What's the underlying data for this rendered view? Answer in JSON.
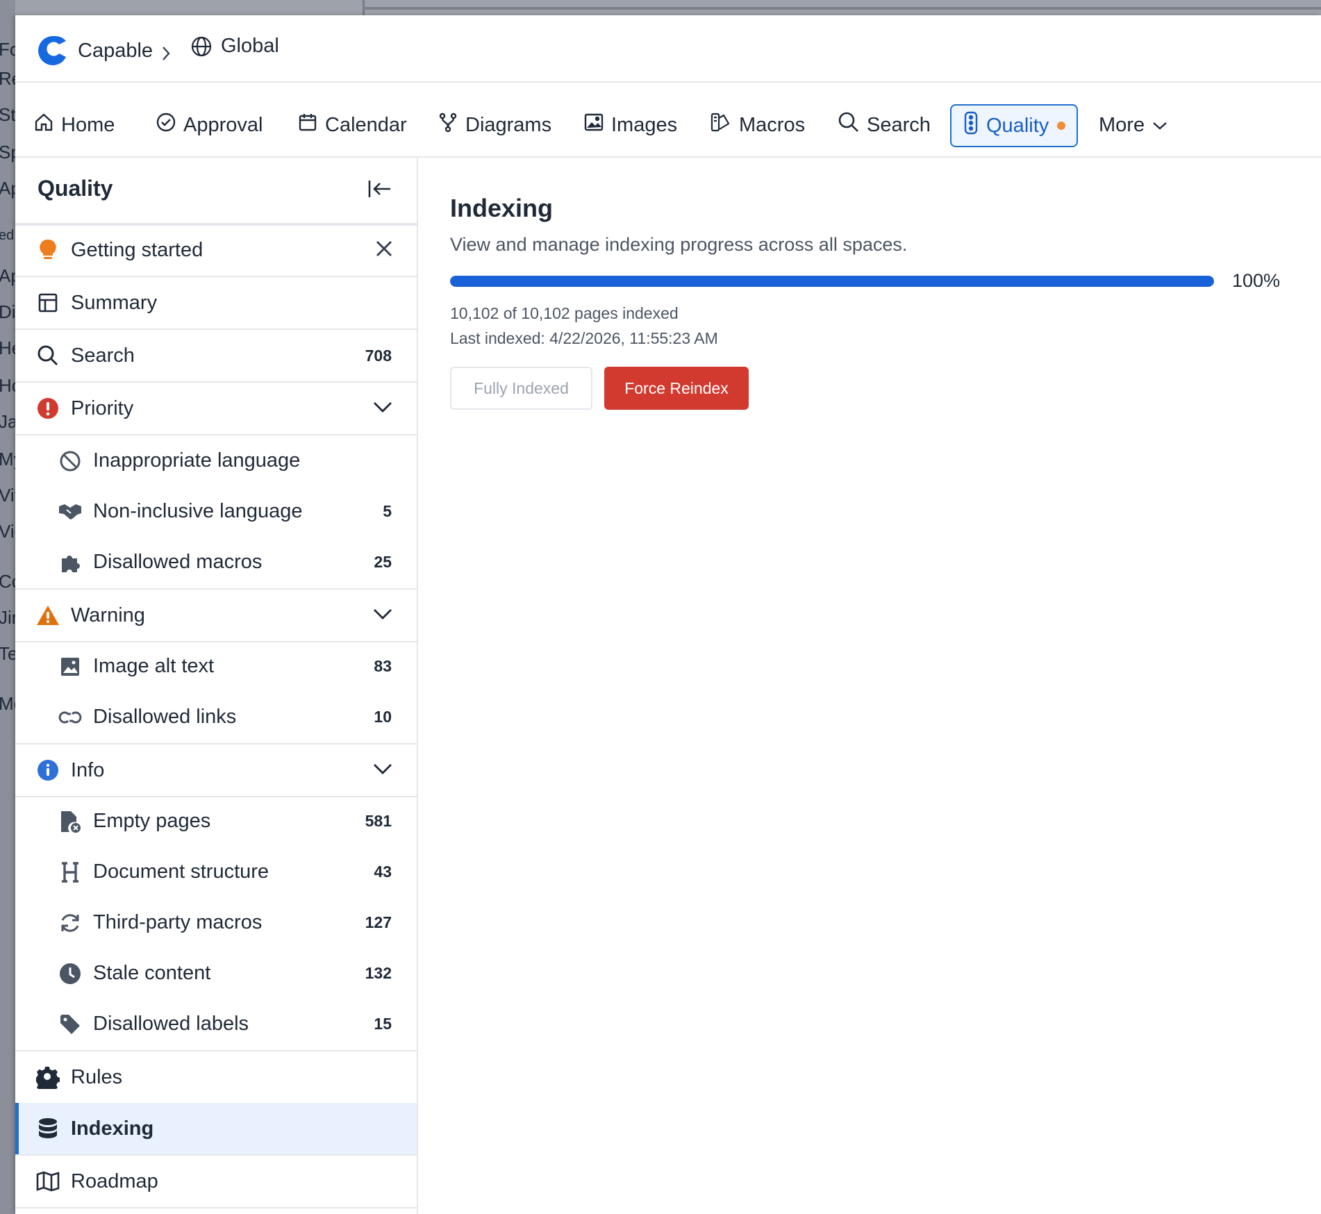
{
  "background": {
    "fragments": [
      "Fo",
      "Re",
      "Sta",
      "Sp",
      "Ap",
      "ed",
      "Ap",
      "Dia",
      "He",
      "Ho",
      "Ja",
      "My",
      "Vit",
      "Vie",
      "Co",
      "Jir",
      "Te",
      "Mo"
    ]
  },
  "breadcrumb": {
    "app_name": "Capable",
    "scope": "Global"
  },
  "nav": {
    "items": [
      {
        "label": "Home",
        "icon": "home-icon"
      },
      {
        "label": "Approval",
        "icon": "check-circle-icon"
      },
      {
        "label": "Calendar",
        "icon": "calendar-icon"
      },
      {
        "label": "Diagrams",
        "icon": "diagram-icon"
      },
      {
        "label": "Images",
        "icon": "image-icon"
      },
      {
        "label": "Macros",
        "icon": "macros-icon"
      },
      {
        "label": "Search",
        "icon": "search-icon"
      },
      {
        "label": "Quality",
        "icon": "traffic-light-icon",
        "active": true
      },
      {
        "label": "More",
        "icon": "chevron-down-icon"
      }
    ],
    "accent_color": "#1f6fd1",
    "badge_color": "#f08c3a"
  },
  "sidebar": {
    "title": "Quality",
    "getting_started": "Getting started",
    "summary": "Summary",
    "search": {
      "label": "Search",
      "count": "708"
    },
    "priority": {
      "label": "Priority",
      "items": [
        {
          "label": "Inappropriate language",
          "count": ""
        },
        {
          "label": "Non-inclusive language",
          "count": "5"
        },
        {
          "label": "Disallowed macros",
          "count": "25"
        }
      ]
    },
    "warning": {
      "label": "Warning",
      "items": [
        {
          "label": "Image alt text",
          "count": "83"
        },
        {
          "label": "Disallowed links",
          "count": "10"
        }
      ]
    },
    "info": {
      "label": "Info",
      "items": [
        {
          "label": "Empty pages",
          "count": "581"
        },
        {
          "label": "Document structure",
          "count": "43"
        },
        {
          "label": "Third-party macros",
          "count": "127"
        },
        {
          "label": "Stale content",
          "count": "132"
        },
        {
          "label": "Disallowed labels",
          "count": "15"
        }
      ]
    },
    "rules": "Rules",
    "indexing": "Indexing",
    "roadmap": "Roadmap"
  },
  "main": {
    "title": "Indexing",
    "subtitle": "View and manage indexing progress across all spaces.",
    "progress_fraction": 1.0,
    "progress_label": "100%",
    "count_text": "10,102 of 10,102 pages indexed",
    "last_indexed": "Last indexed: 4/22/2026, 11:55:23 AM",
    "btn_fully_indexed": "Fully Indexed",
    "btn_force_reindex": "Force Reindex",
    "danger_color": "#d23a2f",
    "progress_color": "#1861d6"
  }
}
